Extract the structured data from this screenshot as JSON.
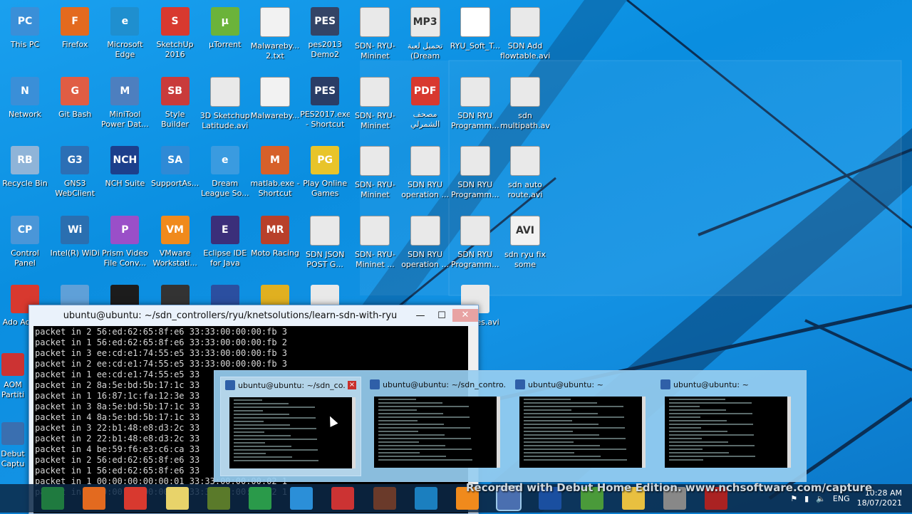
{
  "desktop_icons": [
    {
      "label": "This PC",
      "color": "#3a8fd8",
      "glyph": "PC"
    },
    {
      "label": "Firefox",
      "color": "#e36a1f",
      "glyph": "F"
    },
    {
      "label": "Microsoft Edge",
      "color": "#1f8fcf",
      "glyph": "e"
    },
    {
      "label": "SketchUp 2016",
      "color": "#d8392f",
      "glyph": "S"
    },
    {
      "label": "µTorrent",
      "color": "#6bb33a",
      "glyph": "µ"
    },
    {
      "label": "Malwareby... 2.txt",
      "color": "#f2f2f2",
      "glyph": ""
    },
    {
      "label": "pes2013 Demo2",
      "color": "#334466",
      "glyph": "PES"
    },
    {
      "label": "SDN- RYU- Mininet 2.avi",
      "color": "#e9e9e9",
      "glyph": ""
    },
    {
      "label": "تحميل لعبة (Dream leg...",
      "color": "#e9e9e9",
      "glyph": "MP3"
    },
    {
      "label": "RYU_Soft_T...",
      "color": "#ffffff",
      "glyph": ""
    },
    {
      "label": "SDN Add flowtable.avi",
      "color": "#e9e9e9",
      "glyph": ""
    },
    {
      "label": "Network",
      "color": "#3a8fd8",
      "glyph": "N"
    },
    {
      "label": "Git Bash",
      "color": "#e05d44",
      "glyph": "G"
    },
    {
      "label": "MiniTool Power Dat...",
      "color": "#4d7fbf",
      "glyph": "M"
    },
    {
      "label": "Style Builder 2016",
      "color": "#c93b3b",
      "glyph": "SB"
    },
    {
      "label": "3D Sketchup Latitude.avi",
      "color": "#e9e9e9",
      "glyph": ""
    },
    {
      "label": "Malwareby...",
      "color": "#f2f2f2",
      "glyph": ""
    },
    {
      "label": "PES2017.exe - Shortcut (2)",
      "color": "#2a3d66",
      "glyph": "PES"
    },
    {
      "label": "SDN- RYU- Mininet 3.avi",
      "color": "#e9e9e9",
      "glyph": ""
    },
    {
      "label": "مصحف الشمرلي",
      "color": "#d8392f",
      "glyph": "PDF"
    },
    {
      "label": "SDN RYU Programm...",
      "color": "#e9e9e9",
      "glyph": ""
    },
    {
      "label": "sdn multipath.avi",
      "color": "#e9e9e9",
      "glyph": ""
    },
    {
      "label": "Recycle Bin",
      "color": "#8fb4d8",
      "glyph": "RB"
    },
    {
      "label": "GNS3 WebClient",
      "color": "#2c6fb5",
      "glyph": "G3"
    },
    {
      "label": "NCH Suite",
      "color": "#1c3f8c",
      "glyph": "NCH"
    },
    {
      "label": "SupportAs...",
      "color": "#2e8ad6",
      "glyph": "SA"
    },
    {
      "label": "Dream League So...",
      "color": "#3a9be0",
      "glyph": "e"
    },
    {
      "label": "matlab.exe - Shortcut",
      "color": "#d6602a",
      "glyph": "M"
    },
    {
      "label": "Play Online Games",
      "color": "#e8c42a",
      "glyph": "PG"
    },
    {
      "label": "SDN- RYU- Mininet 4.avi",
      "color": "#e9e9e9",
      "glyph": ""
    },
    {
      "label": "SDN RYU operation ...",
      "color": "#e9e9e9",
      "glyph": ""
    },
    {
      "label": "SDN RYU Programm...",
      "color": "#e9e9e9",
      "glyph": ""
    },
    {
      "label": "sdn auto route.avi",
      "color": "#e9e9e9",
      "glyph": ""
    },
    {
      "label": "Control Panel",
      "color": "#4a96d8",
      "glyph": "CP"
    },
    {
      "label": "Intel(R) WiDi",
      "color": "#2a6fb0",
      "glyph": "Wi"
    },
    {
      "label": "Prism Video File Conv...",
      "color": "#9a4fc8",
      "glyph": "P"
    },
    {
      "label": "VMware Workstati...",
      "color": "#f08a1c",
      "glyph": "VM"
    },
    {
      "label": "Eclipse IDE for Java De...",
      "color": "#3b2f7a",
      "glyph": "E"
    },
    {
      "label": "Moto Racing",
      "color": "#b8402a",
      "glyph": "MR"
    },
    {
      "label": "SDN JSON POST G...",
      "color": "#e9e9e9",
      "glyph": ""
    },
    {
      "label": "SDN- RYU- Mininet ...",
      "color": "#e9e9e9",
      "glyph": ""
    },
    {
      "label": "SDN RYU operation ...",
      "color": "#e9e9e9",
      "glyph": ""
    },
    {
      "label": "SDN RYU Programm...",
      "color": "#e9e9e9",
      "glyph": ""
    },
    {
      "label": "sdn ryu fix some issue...",
      "color": "#f2f2f2",
      "glyph": "AVI"
    }
  ],
  "row5_partial": [
    {
      "label": "Ado Acroba",
      "color": "#d8392f"
    },
    {
      "label": "",
      "color": "#5fa0d8"
    },
    {
      "label": "",
      "color": "#1c1c1c"
    },
    {
      "label": "",
      "color": "#333"
    },
    {
      "label": "",
      "color": "#2b4fa0"
    },
    {
      "label": "",
      "color": "#e0b020"
    },
    {
      "label": "",
      "color": "#e9e9e9"
    },
    {
      "label": "U STP es.avi",
      "color": "#e9e9e9"
    }
  ],
  "left_partial": [
    {
      "label": "AOM Partiti"
    },
    {
      "label": "Debut Captu"
    }
  ],
  "terminal": {
    "title": "ubuntu@ubuntu: ~/sdn_controllers/ryu/knetsolutions/learn-sdn-with-ryu",
    "lines": [
      "packet in 2 56:ed:62:65:8f:e6 33:33:00:00:00:fb 3",
      "packet in 1 56:ed:62:65:8f:e6 33:33:00:00:00:fb 2",
      "packet in 3 ee:cd:e1:74:55:e5 33:33:00:00:00:fb 3",
      "packet in 2 ee:cd:e1:74:55:e5 33:33:00:00:00:fb 3",
      "packet in 1 ee:cd:e1:74:55:e5 33",
      "packet in 2 8a:5e:bd:5b:17:1c 33",
      "packet in 1 16:87:1c:fa:12:3e 33",
      "packet in 3 8a:5e:bd:5b:17:1c 33",
      "packet in 4 8a:5e:bd:5b:17:1c 33",
      "packet in 3 22:b1:48:e8:d3:2c 33",
      "packet in 2 22:b1:48:e8:d3:2c 33",
      "packet in 4 be:59:f6:e3:c6:ca 33",
      "packet in 2 56:ed:62:65:8f:e6 33",
      "packet in 1 56:ed:62:65:8f:e6 33",
      "packet in 1 00:00:00:00:00:01 33:33:00:00:00:02 1",
      "packet in 1 00:00:00:00:00:01 33:33:00:00:00:02 1"
    ]
  },
  "thumbnails": [
    {
      "title": "ubuntu@ubuntu: ~/sdn_co...",
      "active": true,
      "close": "×"
    },
    {
      "title": "ubuntu@ubuntu: ~/sdn_contro...",
      "active": false
    },
    {
      "title": "ubuntu@ubuntu: ~",
      "active": false
    },
    {
      "title": "ubuntu@ubuntu: ~",
      "active": false
    }
  ],
  "taskbar": {
    "apps": [
      {
        "name": "excel",
        "color": "#1f7a3f"
      },
      {
        "name": "firefox",
        "color": "#e36a1f"
      },
      {
        "name": "sketchup",
        "color": "#d8392f"
      },
      {
        "name": "paint",
        "color": "#e8d36a"
      },
      {
        "name": "soccer",
        "color": "#5a7a2a"
      },
      {
        "name": "globe",
        "color": "#2a9a4a"
      },
      {
        "name": "ie",
        "color": "#2b8fd8"
      },
      {
        "name": "scissors",
        "color": "#cc3333"
      },
      {
        "name": "books",
        "color": "#6a3a2a"
      },
      {
        "name": "edge",
        "color": "#1b7fbf"
      },
      {
        "name": "vmware",
        "color": "#f08a1c"
      },
      {
        "name": "putty",
        "color": "#4a6fb0"
      },
      {
        "name": "shield",
        "color": "#1a4fa0"
      },
      {
        "name": "notepad",
        "color": "#4a9a3a"
      },
      {
        "name": "folder",
        "color": "#e8c040"
      },
      {
        "name": "speaker",
        "color": "#888888"
      },
      {
        "name": "debut",
        "color": "#aa2222"
      }
    ],
    "language": "ENG",
    "time": "10:28 AM",
    "date": "18/07/2021"
  },
  "watermark": "Recorded with Debut Home Edition. www.nchsoftware.com/capture"
}
